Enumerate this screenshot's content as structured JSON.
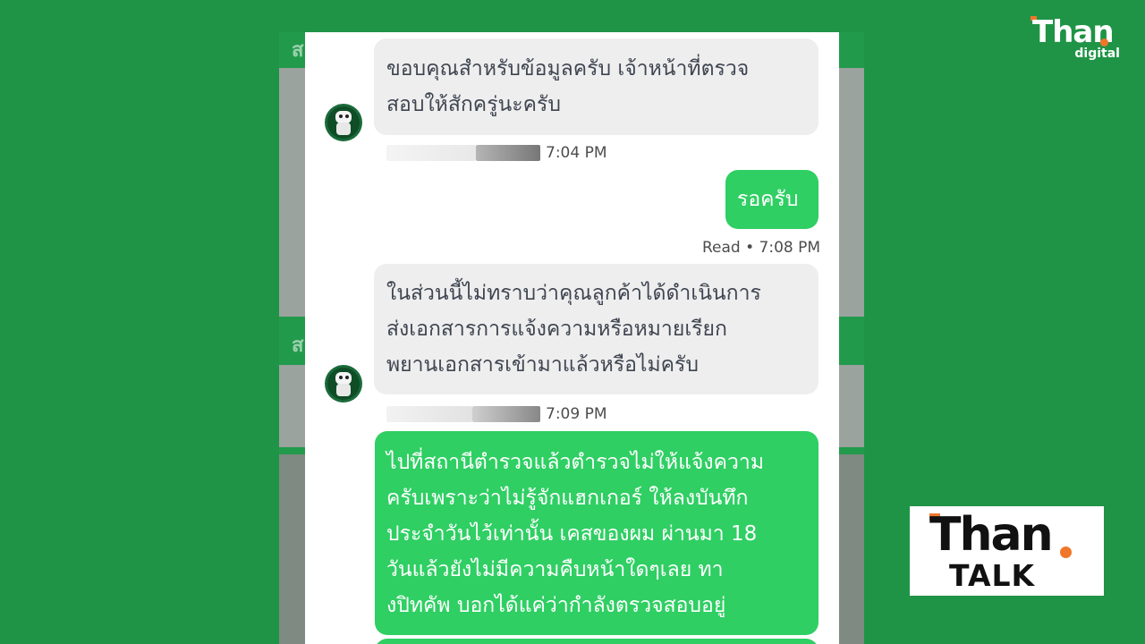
{
  "messages": [
    {
      "direction": "incoming",
      "lines": [
        "ขอบคุณสำหรับข้อมูลครับ เจ้าหน้าที่ตรวจ",
        "สอบให้สักครู่นะครับ"
      ],
      "time": "7:04 PM"
    },
    {
      "direction": "outgoing",
      "lines": [
        "รอครับ"
      ],
      "status": "Read • 7:08 PM"
    },
    {
      "direction": "incoming",
      "lines": [
        "ในส่วนนี้ไม่ทราบว่าคุณลูกค้าได้ดำเนินการ",
        "ส่งเอกสารการแจ้งความหรือหมายเรียก",
        "พยานเอกสารเข้ามาแล้วหรือไม่ครับ"
      ],
      "time": "7:09 PM"
    },
    {
      "direction": "outgoing",
      "lines": [
        "ไปที่สถานีตำรวจแล้วตำรวจไม่ให้แจ้งความ",
        "ครับเพราะว่าไม่รู้จักแฮกเกอร์ ให้ลงบันทึก",
        "ประจำวันไว้เท่านั้น เคสของผม ผ่านมา 18",
        "วันแล้วยังไม่มีความคืบหน้าใดๆเลย ทา",
        "งปิทคัพ บอกได้แค่ว่ากำลังตรวจสอบอยู่"
      ]
    }
  ],
  "background_fragments": [
    "ส",
    "ส"
  ],
  "logo_top": {
    "word": "Than",
    "sub": "digital"
  },
  "logo_talk": {
    "word": "Than",
    "sub": "TALK"
  },
  "colors": {
    "page_bg": "#1f9446",
    "outgoing_bubble": "#2fcf63",
    "incoming_bubble": "#eeeeef",
    "accent": "#f0762a"
  }
}
